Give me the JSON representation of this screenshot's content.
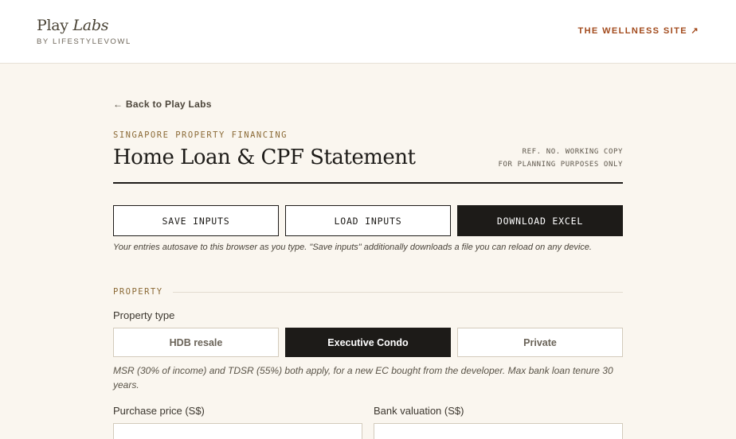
{
  "header": {
    "brand_name": "Play",
    "brand_name_italic": "Labs",
    "brand_sub": "BY LIFESTYLEVOWL",
    "wellness_link": "THE WELLNESS SITE ↗"
  },
  "nav": {
    "back_label": "← Back to Play Labs"
  },
  "page": {
    "eyebrow": "SINGAPORE PROPERTY FINANCING",
    "title": "Home Loan & CPF Statement",
    "ref_line1": "REF. NO. WORKING COPY",
    "ref_line2": "FOR PLANNING PURPOSES ONLY"
  },
  "actions": {
    "save_label": "SAVE INPUTS",
    "load_label": "LOAD INPUTS",
    "download_label": "DOWNLOAD EXCEL",
    "autosave_note": "Your entries autosave to this browser as you type. \"Save inputs\" additionally downloads a file you can reload on any device."
  },
  "property": {
    "section_label": "PROPERTY",
    "type_label": "Property type",
    "options": [
      "HDB resale",
      "Executive Condo",
      "Private"
    ],
    "selected": "Executive Condo",
    "note": "MSR (30% of income) and TDSR (55%) both apply, for a new EC bought from the developer. Max bank loan tenure 30 years.",
    "purchase_price_label": "Purchase price (S$)",
    "purchase_price_value": "",
    "bank_valuation_label": "Bank valuation (S$)",
    "bank_valuation_value": ""
  },
  "colors": {
    "background": "#faf6ef",
    "ink": "#1d1b18",
    "accent_rust": "#a24a1c",
    "accent_gold": "#8b6a36"
  }
}
